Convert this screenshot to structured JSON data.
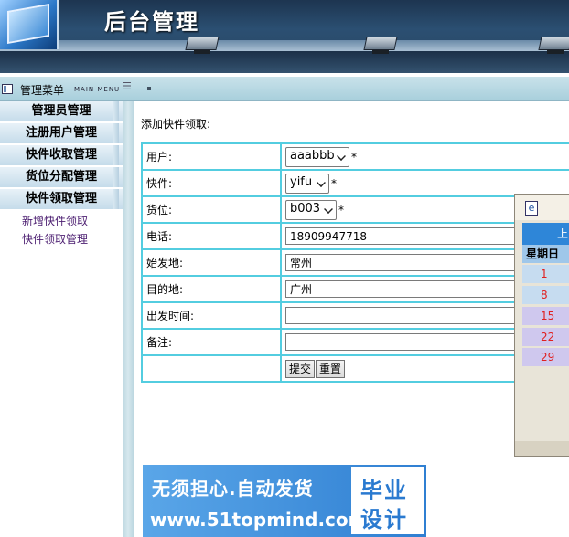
{
  "header": {
    "title": "后台管理"
  },
  "topbar": {
    "menu_title": "管理菜单",
    "menu_subtitle": "MAIN MENU"
  },
  "sidebar": {
    "heads": [
      "管理员管理",
      "注册用户管理",
      "快件收取管理",
      "货位分配管理",
      "快件领取管理"
    ],
    "subitems": [
      "新增快件领取",
      "快件领取管理"
    ]
  },
  "main": {
    "heading": "添加快件领取:",
    "form": {
      "user_label": "用户:",
      "user_value": "aaabbb",
      "parcel_label": "快件:",
      "parcel_value": "yifu",
      "slot_label": "货位:",
      "slot_value": "b003",
      "required_mark": "*",
      "phone_label": "电话:",
      "phone_value": "18909947718",
      "origin_label": "始发地:",
      "origin_value": "常州",
      "dest_label": "目的地:",
      "dest_value": "广州",
      "depart_label": "出发时间:",
      "depart_value": "",
      "note_label": "备注:",
      "note_value": "",
      "submit_label": "提交",
      "reset_label": "重置"
    }
  },
  "calendar": {
    "header_text": "上",
    "weekday": "星期日",
    "days": [
      "1",
      "8",
      "15",
      "22",
      "29"
    ],
    "row_colors": [
      "#c6dcf0",
      "#c6dcf0",
      "#cfc8ee",
      "#cfc8ee",
      "#cfc8ee"
    ]
  },
  "banner": {
    "line1": "无须担心.自动发货",
    "line2": "www.51topmind.com",
    "badge_line1": "毕业",
    "badge_line2": "设计"
  },
  "colors": {
    "table_border": "#53cde0",
    "sidebar_link": "#4b1d70",
    "calendar_header": "#2e86d8"
  }
}
